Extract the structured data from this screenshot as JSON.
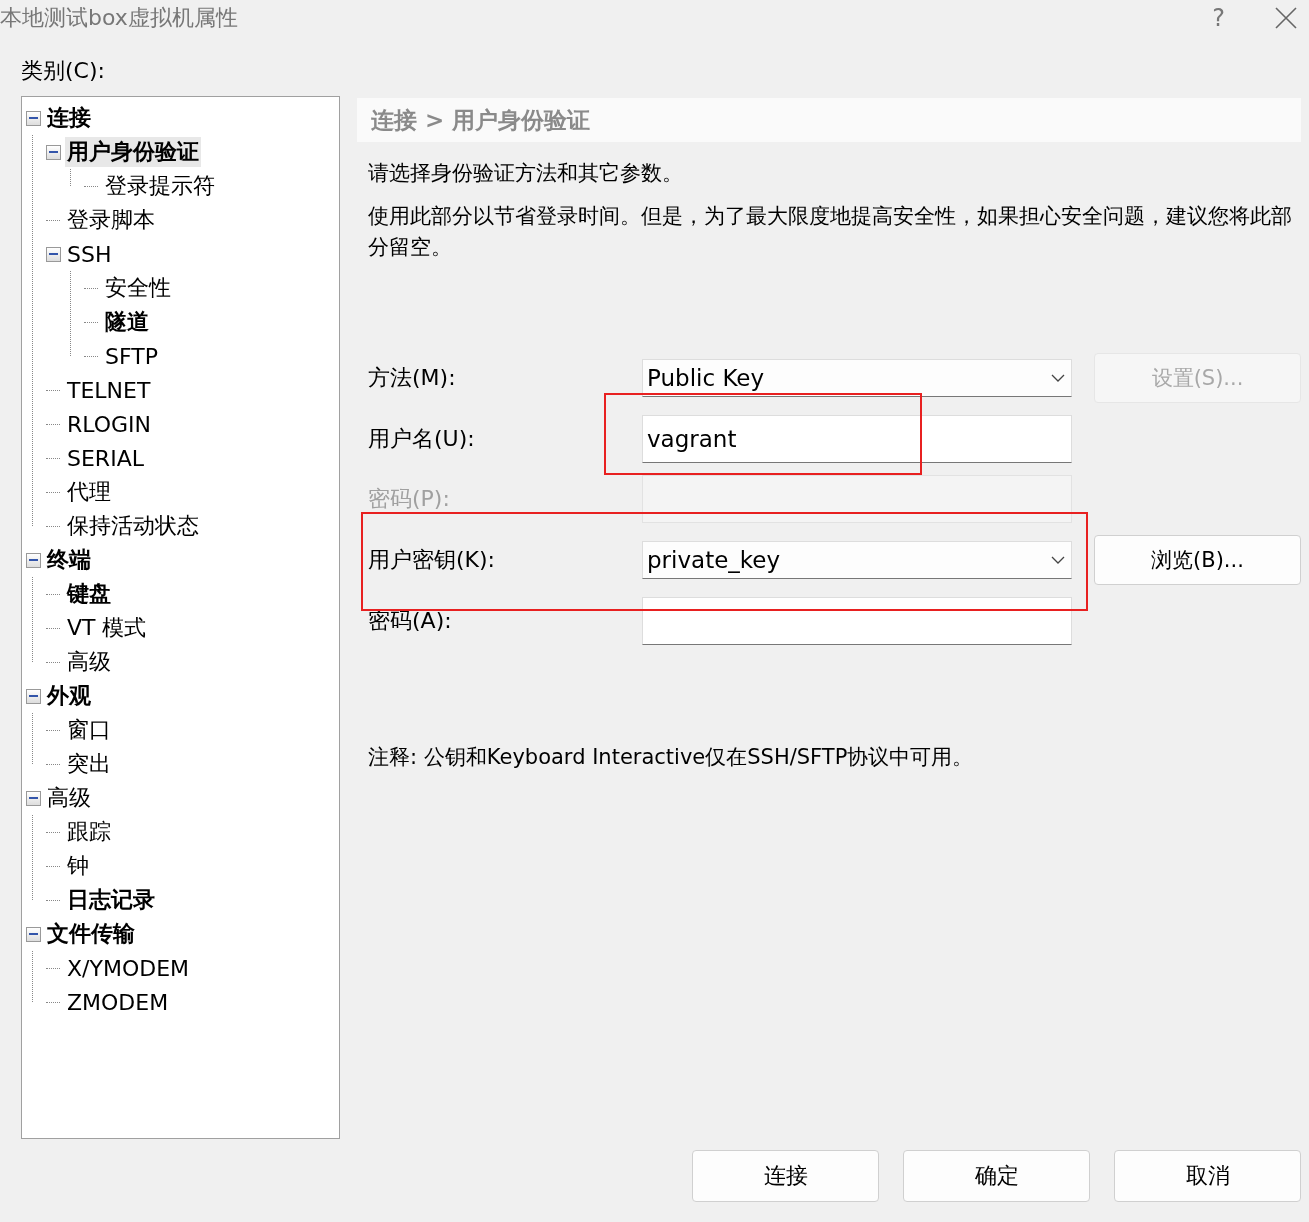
{
  "window": {
    "title": "本地测试box虚拟机属性",
    "help": "?"
  },
  "category_label": "类别(C):",
  "tree": [
    {
      "label": "连接",
      "bold": true,
      "selected": false,
      "expanded": true,
      "children": [
        {
          "label": "用户身份验证",
          "bold": true,
          "selected": true,
          "expanded": true,
          "children": [
            {
              "label": "登录提示符",
              "bold": false,
              "selected": false
            }
          ]
        },
        {
          "label": "登录脚本",
          "bold": false,
          "selected": false
        },
        {
          "label": "SSH",
          "bold": false,
          "selected": false,
          "expanded": true,
          "children": [
            {
              "label": "安全性",
              "bold": false,
              "selected": false
            },
            {
              "label": "隧道",
              "bold": true,
              "selected": false
            },
            {
              "label": "SFTP",
              "bold": false,
              "selected": false
            }
          ]
        },
        {
          "label": "TELNET",
          "bold": false,
          "selected": false
        },
        {
          "label": "RLOGIN",
          "bold": false,
          "selected": false
        },
        {
          "label": "SERIAL",
          "bold": false,
          "selected": false
        },
        {
          "label": "代理",
          "bold": false,
          "selected": false
        },
        {
          "label": "保持活动状态",
          "bold": false,
          "selected": false
        }
      ]
    },
    {
      "label": "终端",
      "bold": true,
      "selected": false,
      "expanded": true,
      "children": [
        {
          "label": "键盘",
          "bold": true,
          "selected": false
        },
        {
          "label": "VT 模式",
          "bold": false,
          "selected": false
        },
        {
          "label": "高级",
          "bold": false,
          "selected": false
        }
      ]
    },
    {
      "label": "外观",
      "bold": true,
      "selected": false,
      "expanded": true,
      "children": [
        {
          "label": "窗口",
          "bold": false,
          "selected": false
        },
        {
          "label": "突出",
          "bold": false,
          "selected": false
        }
      ]
    },
    {
      "label": "高级",
      "bold": false,
      "selected": false,
      "expanded": true,
      "children": [
        {
          "label": "跟踪",
          "bold": false,
          "selected": false
        },
        {
          "label": "钟",
          "bold": false,
          "selected": false
        },
        {
          "label": "日志记录",
          "bold": true,
          "selected": false
        }
      ]
    },
    {
      "label": "文件传输",
      "bold": true,
      "selected": false,
      "expanded": true,
      "children": [
        {
          "label": "X/YMODEM",
          "bold": false,
          "selected": false
        },
        {
          "label": "ZMODEM",
          "bold": false,
          "selected": false
        }
      ]
    }
  ],
  "breadcrumb": "连接 > 用户身份验证",
  "description": [
    "请选择身份验证方法和其它参数。",
    "使用此部分以节省登录时间。但是，为了最大限度地提高安全性，如果担心安全问题，建议您将此部分留空。"
  ],
  "fields": [
    {
      "label": "方法(M):",
      "kind": "select",
      "value": "Public Key",
      "disabled": false,
      "button": {
        "label": "设置(S)...",
        "disabled": true
      }
    },
    {
      "label": "用户名(U):",
      "kind": "text",
      "value": "vagrant",
      "disabled": false
    },
    {
      "label": "密码(P):",
      "kind": "password",
      "disabled": true
    },
    {
      "label": "用户密钥(K):",
      "kind": "select",
      "value": "private_key",
      "disabled": false,
      "button": {
        "label": "浏览(B)...",
        "disabled": false
      }
    },
    {
      "label": "密码(A):",
      "kind": "password",
      "disabled": false
    }
  ],
  "note": "注释: 公钥和Keyboard Interactive仅在SSH/SFTP协议中可用。",
  "buttons": [
    "连接",
    "确定",
    "取消"
  ]
}
